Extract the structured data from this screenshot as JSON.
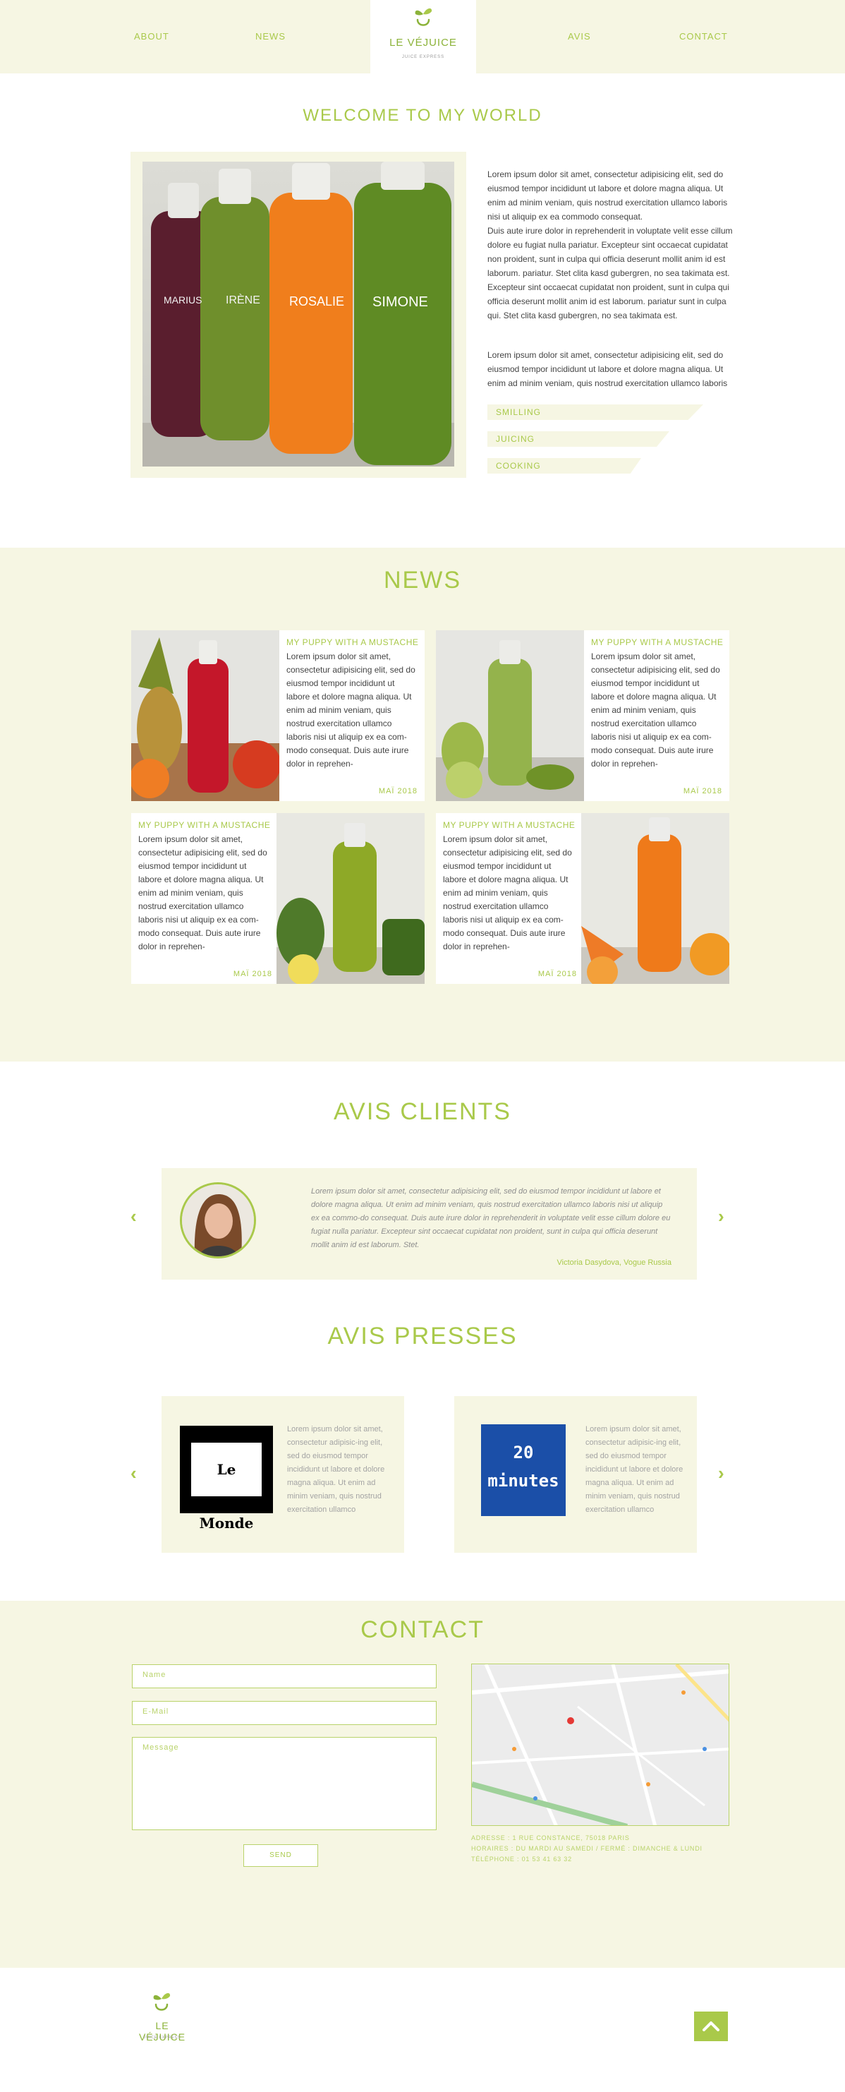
{
  "nav": {
    "about": "ABOUT",
    "news": "NEWS",
    "avis": "AVIS",
    "contact": "CONTACT"
  },
  "brand": {
    "name": "LE VÉJUICE",
    "tagline": "JUICE EXPRESS",
    "accent_color": "#a9c94a",
    "cream_color": "#f6f6e3"
  },
  "welcome": {
    "title": "WELCOME TO MY WORLD",
    "paragraph_1": "Lorem ipsum dolor sit amet, consectetur adipisicing elit, sed do eiusmod tempor incididunt ut labore et dolore magna aliqua. Ut enim ad minim veniam, quis nostrud exercitation ullamco laboris nisi ut aliquip ex ea commodo consequat.",
    "paragraph_2": "Duis aute irure dolor in reprehenderit in voluptate velit esse cillum dolore eu fugiat nulla pariatur. Excepteur sint occaecat cupidatat non proident, sunt in culpa qui officia deserunt mollit anim id est laborum. pariatur. Stet clita kasd gubergren, no sea takimata est. Excepteur sint occaecat cupidatat non proident, sunt in culpa qui officia deserunt mollit anim id est laborum. pariatur sunt in culpa qui. Stet clita kasd gubergren, no sea takimata est.",
    "paragraph_3": "Lorem ipsum dolor sit amet, consectetur adipisicing elit, sed do eiusmod tempor incididunt ut labore et dolore magna aliqua. Ut enim ad minim veniam, quis nostrud exercitation ullamco laboris",
    "skills": [
      "SMILLING",
      "JUICING",
      "COOKING"
    ],
    "bottle_labels": [
      "MARIUS",
      "IRÈNE",
      "ROSALIE",
      "SIMONE"
    ]
  },
  "news": {
    "title": "NEWS",
    "items": [
      {
        "headline": "MY PUPPY WITH A MUSTACHE",
        "text": "Lorem ipsum dolor sit amet, consectetur adipisicing elit, sed do eiusmod tempor incididunt ut labore et dolore magna aliqua. Ut enim ad minim veniam, quis nostrud exercitation ullamco laboris nisi ut aliquip ex ea com-modo consequat. Duis aute irure dolor in reprehen-",
        "date": "MAÏ 2018",
        "image": "red-juice-bottle"
      },
      {
        "headline": "MY PUPPY WITH A MUSTACHE",
        "text": "Lorem ipsum dolor sit amet, consectetur adipisicing elit, sed do eiusmod tempor incididunt ut labore et dolore magna aliqua. Ut enim ad minim veniam, quis nostrud exercitation ullamco laboris nisi ut aliquip ex ea com-modo consequat. Duis aute irure dolor in reprehen-",
        "date": "MAÏ 2018",
        "image": "light-green-juice-bottle"
      },
      {
        "headline": "MY PUPPY WITH A MUSTACHE",
        "text": "Lorem ipsum dolor sit amet, consectetur adipisicing elit, sed do eiusmod tempor incididunt ut labore et dolore magna aliqua. Ut enim ad minim veniam, quis nostrud exercitation ullamco laboris nisi ut aliquip ex ea com-modo consequat. Duis aute irure dolor in reprehen-",
        "date": "MAÏ 2018",
        "image": "green-juice-bottle"
      },
      {
        "headline": "MY PUPPY WITH A MUSTACHE",
        "text": "Lorem ipsum dolor sit amet, consectetur adipisicing elit, sed do eiusmod tempor incididunt ut labore et dolore magna aliqua. Ut enim ad minim veniam, quis nostrud exercitation ullamco laboris nisi ut aliquip ex ea com-modo consequat. Duis aute irure dolor in reprehen-",
        "date": "MAÏ 2018",
        "image": "orange-juice-bottle"
      }
    ]
  },
  "clients": {
    "title": "AVIS CLIENTS",
    "quote": "Lorem ipsum dolor sit amet, consectetur adipisicing elit, sed do eiusmod tempor incididunt ut labore et dolore magna aliqua. Ut enim ad minim veniam, quis nostrud exercitation ullamco laboris nisi ut aliquip ex ea commo-do consequat. Duis aute irure dolor in reprehenderit in voluptate velit esse cillum dolore eu fugiat nulla pariatur. Excepteur sint occaecat cupidatat non proident, sunt in culpa qui officia deserunt mollit anim id est laborum. Stet.",
    "author": "Victoria Dasydova, Vogue Russia",
    "prev_icon": "chevron-left-icon",
    "next_icon": "chevron-right-icon"
  },
  "presses": {
    "title": "AVIS PRESSES",
    "items": [
      {
        "logo_text": "Le Monde",
        "text": "Lorem ipsum dolor sit amet, consectetur adipisic-ing elit, sed do eiusmod tempor incididunt ut labore et dolore magna aliqua. Ut enim ad minim veniam, quis nostrud exercitation ullamco"
      },
      {
        "logo_text": "20 minutes",
        "text": "Lorem ipsum dolor sit amet, consectetur adipisic-ing elit, sed do eiusmod tempor incididunt ut labore et dolore magna aliqua. Ut enim ad minim veniam, quis nostrud exercitation ullamco"
      }
    ]
  },
  "contact": {
    "title": "CONTACT",
    "name_placeholder": "Name",
    "email_placeholder": "E-Mail",
    "message_placeholder": "Message",
    "send_label": "SEND",
    "address": "ADRESSE : 1 RUE CONSTANCE, 75018 PARIS",
    "hours": "HORAIRES : DU MARDI AU SAMEDI / FERMÉ : DIMANCHE & LUNDI",
    "phone": "TÉLÉPHONE : 01 53 41 63 32"
  },
  "footer": {
    "back_to_top_icon": "chevron-up-icon"
  }
}
